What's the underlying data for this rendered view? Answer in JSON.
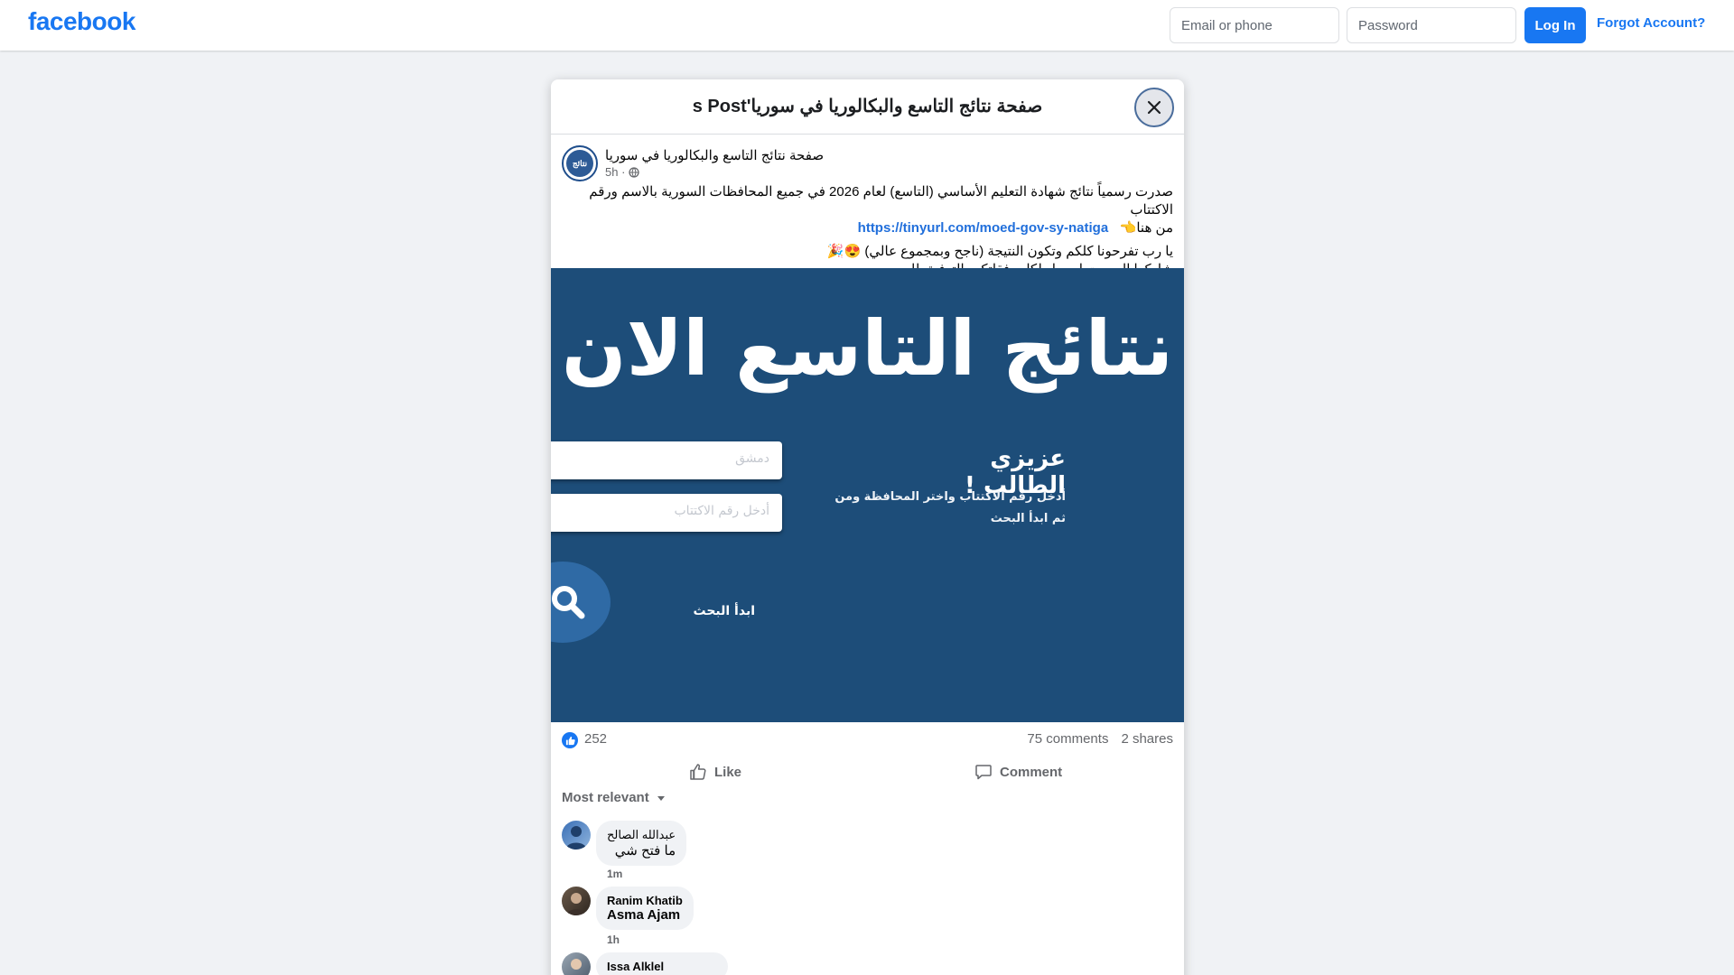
{
  "brand": {
    "logo_text": "facebook",
    "color": "#1877f2"
  },
  "login": {
    "email_placeholder": "Email or phone",
    "password_placeholder": "Password",
    "login_label": "Log In",
    "forgot_label": "Forgot Account?"
  },
  "modal": {
    "title": "صفحة نتائج التاسع والبكالوريا في سوريا's Post",
    "close_icon": "close-icon"
  },
  "post": {
    "page_name": "صفحة نتائج التاسع والبكالوريا في سوريا",
    "avatar_text": "نتائج",
    "time": "5h ·",
    "line1": "صدرت رسمياً نتائج شهادة التعليم الأساسي (التاسع) لعام 2026 في جميع المحافظات السورية بالاسم ورقم الاكتتاب",
    "line2_prefix": "من هنا👈",
    "link": "https://tinyurl.com/moed-gov-sy-natiga",
    "line3": "يا رب تفرحونا كلكم وتكون النتيجة (ناجح وبمجموع عالي) 😍🎉",
    "line4": "شاركوا البوست ليوصل لكل رفقاتكم بالتوفيق للجميع",
    "image": {
      "title": "نتائج التاسع الان",
      "field1": "دمشق",
      "field2": "أدخل رقم الاكتتاب",
      "heading": "عزيزي الطالب !",
      "line1": "أدخل رقم الاكتتاب واختر المحافظة ومن",
      "line2": "ثم ابدأ البحث",
      "search_label": "ابدأ البحث",
      "background": "#1d4d79"
    }
  },
  "stats": {
    "likes": "252",
    "comments": "75 comments",
    "shares": "2 shares"
  },
  "actions": {
    "like_label": "Like",
    "comment_label": "Comment"
  },
  "filter": {
    "label": "Most relevant"
  },
  "comments": [
    {
      "name": "عبدالله الصالح",
      "text": "ما فتح شي",
      "time": "1m"
    },
    {
      "name": "Ranim Khatib",
      "text": "Asma Ajam",
      "time": "1h"
    },
    {
      "name": "Issa Alklel"
    }
  ]
}
